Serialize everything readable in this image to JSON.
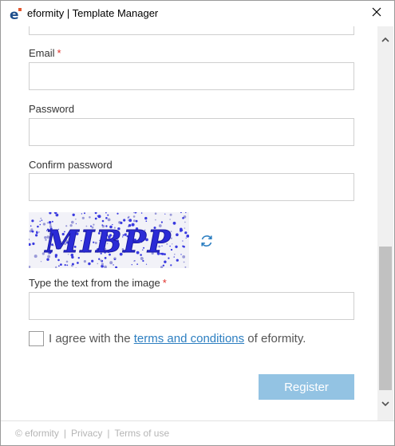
{
  "window": {
    "title": "eformity | Template Manager",
    "icon": "eformity-logo-icon"
  },
  "form": {
    "email_label": "Email",
    "password_label": "Password",
    "confirm_password_label": "Confirm password",
    "captcha_label": "Type the text from the image",
    "required_marker": "*",
    "captcha_text": "MIBPP",
    "agree_prefix": "I agree with the ",
    "agree_link": "terms and conditions",
    "agree_suffix": " of eformity.",
    "register_label": "Register"
  },
  "footer": {
    "copyright": "© eformity",
    "privacy": "Privacy",
    "terms": "Terms of use",
    "separator": "|"
  },
  "colors": {
    "accent": "#2d7fc1",
    "button": "#93c3e3",
    "required": "#e0302a",
    "captcha_ink": "#2a2ad6"
  }
}
